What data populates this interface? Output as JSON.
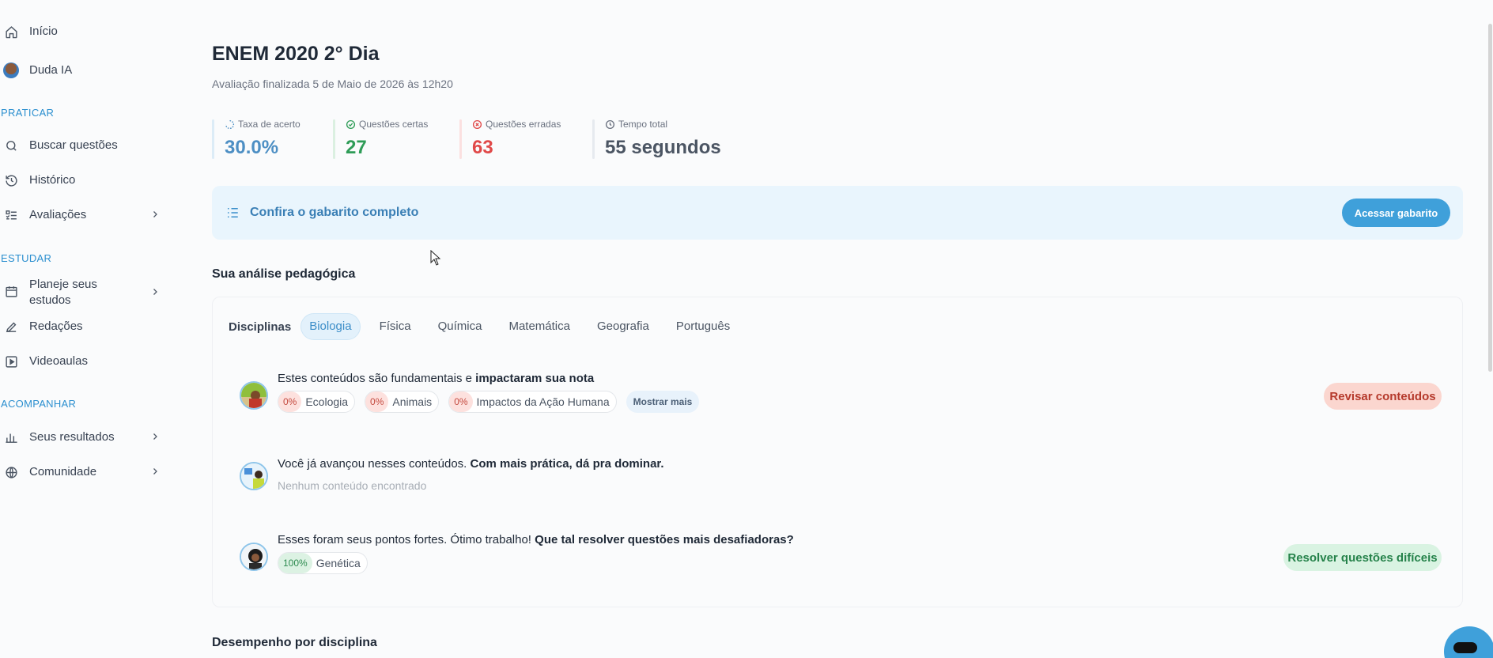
{
  "sidebar": {
    "items_top": [
      {
        "label": "Início",
        "icon": "home-icon"
      },
      {
        "label": "Duda IA",
        "icon": "avatar"
      }
    ],
    "sections": [
      {
        "title": "PRATICAR",
        "items": [
          {
            "label": "Buscar questões",
            "icon": "search-icon"
          },
          {
            "label": "Histórico",
            "icon": "history-icon"
          },
          {
            "label": "Avaliações",
            "icon": "list-check-icon",
            "has_chevron": true
          }
        ]
      },
      {
        "title": "ESTUDAR",
        "items": [
          {
            "label_line1": "Planeje seus",
            "label_line2": "estudos",
            "icon": "calendar-icon",
            "has_chevron": true
          },
          {
            "label": "Redações",
            "icon": "pencil-icon"
          },
          {
            "label": "Videoaulas",
            "icon": "play-icon"
          }
        ]
      },
      {
        "title": "ACOMPANHAR",
        "items": [
          {
            "label": "Seus resultados",
            "icon": "bar-chart-icon",
            "has_chevron": true
          },
          {
            "label": "Comunidade",
            "icon": "globe-icon",
            "has_chevron": true
          }
        ]
      }
    ]
  },
  "header": {
    "title": "ENEM 2020 2° Dia",
    "subtitle": "Avaliação finalizada 5 de Maio de 2026 às 12h20"
  },
  "stats": [
    {
      "label": "Taxa de acerto",
      "value": "30.0%",
      "color": "#4d8fc4",
      "icon": "progress-icon"
    },
    {
      "label": "Questões certas",
      "value": "27",
      "color": "#2e9c57",
      "icon": "check-circle-icon"
    },
    {
      "label": "Questões erradas",
      "value": "63",
      "color": "#e04848",
      "icon": "x-circle-icon"
    },
    {
      "label": "Tempo total",
      "value": "55 segundos",
      "color": "#4b5563",
      "icon": "clock-icon"
    }
  ],
  "banner": {
    "text": "Confira o gabarito completo",
    "button": "Acessar gabarito",
    "icon": "list-icon"
  },
  "analysis": {
    "title": "Sua análise pedagógica",
    "tabs_label": "Disciplinas",
    "tabs": [
      "Biologia",
      "Física",
      "Química",
      "Matemática",
      "Geografia",
      "Português"
    ],
    "active_tab": "Biologia",
    "rows": [
      {
        "text_plain": "Estes conteúdos são fundamentais e ",
        "text_bold": "impactaram sua nota",
        "chips": [
          {
            "pct": "0%",
            "label": "Ecologia"
          },
          {
            "pct": "0%",
            "label": "Animais"
          },
          {
            "pct": "0%",
            "label": "Impactos da Ação Humana"
          }
        ],
        "more": "Mostrar mais",
        "action": "Revisar conteúdos"
      },
      {
        "text_plain": "Você já avançou nesses conteúdos. ",
        "text_bold": "Com mais prática, dá pra dominar.",
        "empty": "Nenhum conteúdo encontrado"
      },
      {
        "text_plain": "Esses foram seus pontos fortes. Ótimo trabalho! ",
        "text_bold": "Que tal resolver questões mais desafiadoras?",
        "chips": [
          {
            "pct": "100%",
            "label": "Genética"
          }
        ],
        "action": "Resolver questões difíceis"
      }
    ]
  },
  "performance": {
    "title": "Desempenho por disciplina"
  },
  "colors": {
    "accent": "#3fa0da",
    "section_heading": "#2b8fcf"
  }
}
